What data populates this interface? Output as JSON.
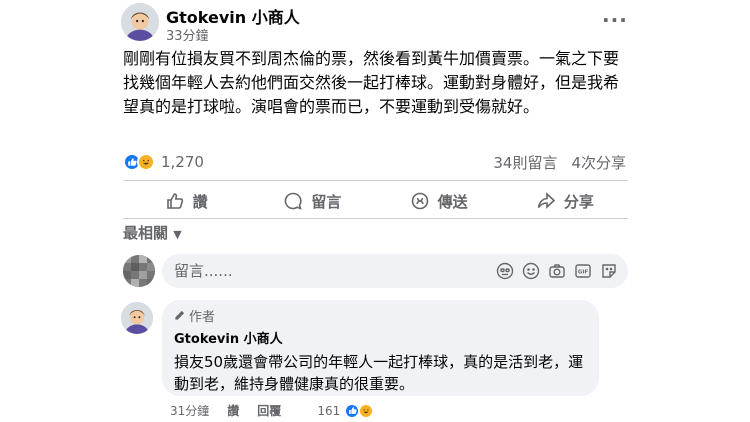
{
  "post": {
    "author": "Gtokevin 小商人",
    "time": "33分鐘",
    "more_label": "···",
    "text": "剛剛有位損友買不到周杰倫的票，然後看到黃牛加價賣票。一氣之下要找幾個年輕人去約他們面交然後一起打棒球。運動對身體好，但是我希望真的是打球啦。演唱會的票而已，不要運動到受傷就好。",
    "reaction_count": "1,270",
    "comments_count": "34則留言",
    "shares_count": "4次分享"
  },
  "actions": {
    "like": "讚",
    "comment": "留言",
    "send": "傳送",
    "share": "分享"
  },
  "sort_label": "最相關",
  "composer": {
    "placeholder": "留言......"
  },
  "reply": {
    "badge": "作者",
    "name": "Gtokevin 小商人",
    "text": "損友50歲還會帶公司的年輕人一起打棒球，真的是活到老，運動到老，維持身體健康真的很重要。",
    "time": "31分鐘",
    "like_label": "讚",
    "reply_label": "回覆",
    "reaction_count": "161"
  },
  "colors": {
    "like_blue": "#1877f2",
    "haha_yellow": "#f7b125",
    "secondary_text": "#65676b",
    "bubble_bg": "#f0f2f5"
  },
  "icons": [
    "like-reaction-icon",
    "haha-reaction-icon",
    "thumbs-up-icon",
    "comment-icon",
    "messenger-icon",
    "share-icon",
    "emoji-icon",
    "camera-icon",
    "gif-icon",
    "sticker-icon",
    "pencil-icon",
    "more-icon"
  ]
}
